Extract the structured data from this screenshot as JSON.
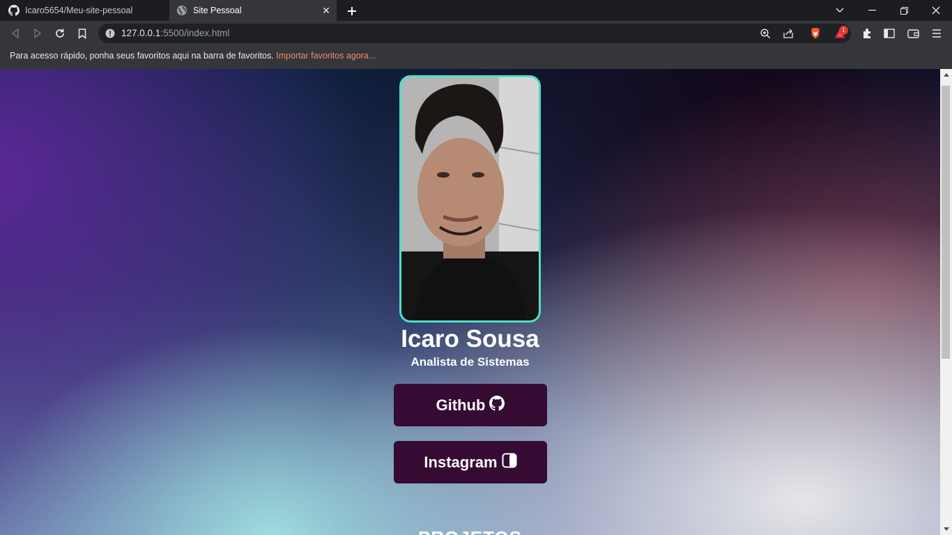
{
  "browser": {
    "tabs": [
      {
        "title": "Icaro5654/Meu-site-pessoal",
        "icon": "github-icon",
        "active": false
      },
      {
        "title": "Site Pessoal",
        "icon": "globe-icon",
        "active": true
      }
    ],
    "url_host": "127.0.0.1",
    "url_rest": ":5500/index.html",
    "bookmarks_bar": {
      "message": "Para acesso rápido, ponha seus favoritos aqui na barra de favoritos. ",
      "import_link": "Importar favoritos agora..."
    },
    "rewards_badge": "1"
  },
  "profile": {
    "photo": "profile-photo",
    "name": "Icaro Sousa",
    "role": "Analista de Sistemas"
  },
  "links": {
    "github_label": "Github",
    "instagram_label": "Instagram"
  },
  "next_section_title": "PROJETOS",
  "colors": {
    "accent_border": "#4fe0c6",
    "button_bg": "#350b34",
    "link_orange": "#f28b6d"
  }
}
